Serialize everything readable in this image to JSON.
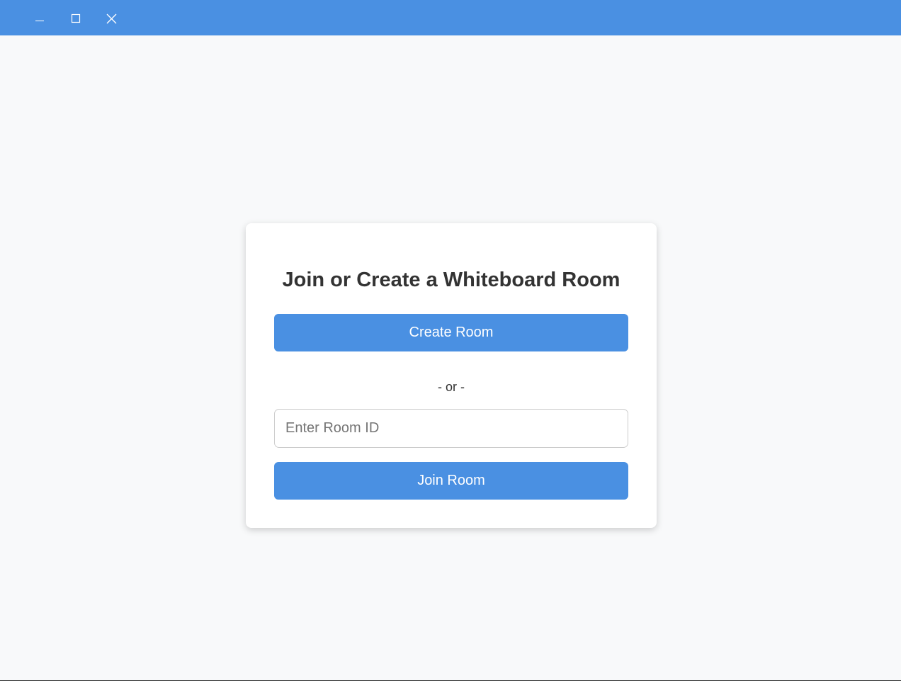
{
  "window": {
    "controls": [
      {
        "name": "minimize-icon"
      },
      {
        "name": "maximize-icon"
      },
      {
        "name": "close-icon"
      }
    ],
    "accent_color": "#4a90e2"
  },
  "card": {
    "title": "Join or Create a Whiteboard Room",
    "create_button_label": "Create Room",
    "divider_text": "- or -",
    "room_input": {
      "placeholder": "Enter Room ID",
      "value": ""
    },
    "join_button_label": "Join Room"
  }
}
